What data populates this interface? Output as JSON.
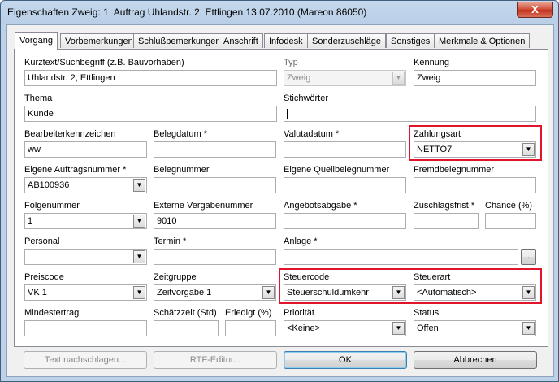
{
  "window": {
    "title": "Eigenschaften Zweig: 1. Auftrag Uhlandstr. 2, Ettlingen 13.07.2010 (Mareon 86050)",
    "close_label": "X"
  },
  "tabs": [
    "Vorgang",
    "Vorbemerkungen",
    "Schlußbemerkungen",
    "Anschrift",
    "Infodesk",
    "Sonderzuschläge",
    "Sonstiges",
    "Merkmale & Optionen"
  ],
  "fields": {
    "kurztext": {
      "label": "Kurztext/Suchbegriff (z.B. Bauvorhaben)",
      "value": "Uhlandstr. 2, Ettlingen"
    },
    "typ": {
      "label": "Typ",
      "value": "Zweig"
    },
    "kennung": {
      "label": "Kennung",
      "value": "Zweig"
    },
    "thema": {
      "label": "Thema",
      "value": "Kunde"
    },
    "stichwoerter": {
      "label": "Stichwörter",
      "value": ""
    },
    "bearbeiterkennzeichen": {
      "label": "Bearbeiterkennzeichen",
      "value": "ww"
    },
    "belegdatum": {
      "label": "Belegdatum *",
      "value": ""
    },
    "valutadatum": {
      "label": "Valutadatum *",
      "value": ""
    },
    "zahlungsart": {
      "label": "Zahlungsart",
      "value": "NETTO7"
    },
    "eigene_auftragsnummer": {
      "label": "Eigene Auftragsnummer *",
      "value": "AB100936"
    },
    "belegnummer": {
      "label": "Belegnummer",
      "value": ""
    },
    "eigene_quellbelegnummer": {
      "label": "Eigene Quellbelegnummer",
      "value": ""
    },
    "fremdbelegnummer": {
      "label": "Fremdbelegnummer",
      "value": ""
    },
    "folgenummer": {
      "label": "Folgenummer",
      "value": "1"
    },
    "externe_vergabenummer": {
      "label": "Externe Vergabenummer",
      "value": "9010"
    },
    "angebotsabgabe": {
      "label": "Angebotsabgabe *",
      "value": ""
    },
    "zuschlagsfrist": {
      "label": "Zuschlagsfrist *",
      "value": ""
    },
    "chance": {
      "label": "Chance (%)",
      "value": ""
    },
    "personal": {
      "label": "Personal",
      "value": ""
    },
    "termin": {
      "label": "Termin *",
      "value": ""
    },
    "anlage": {
      "label": "Anlage *",
      "value": "",
      "browse_label": "..."
    },
    "preiscode": {
      "label": "Preiscode",
      "value": "VK 1"
    },
    "zeitgruppe": {
      "label": "Zeitgruppe",
      "value": "Zeitvorgabe 1"
    },
    "steuercode": {
      "label": "Steuercode",
      "value": "Steuerschuldumkehr"
    },
    "steuerart": {
      "label": "Steuerart",
      "value": "<Automatisch>"
    },
    "mindestertrag": {
      "label": "Mindestertrag",
      "value": ""
    },
    "schaetzzeit": {
      "label": "Schätzzeit (Std)",
      "value": ""
    },
    "erledigt": {
      "label": "Erledigt (%)",
      "value": ""
    },
    "prioritaet": {
      "label": "Priorität",
      "value": "<Keine>"
    },
    "status": {
      "label": "Status",
      "value": "Offen"
    }
  },
  "buttons": {
    "text_nachschlagen": "Text nachschlagen...",
    "rtf_editor": "RTF-Editor...",
    "ok": "OK",
    "abbrechen": "Abbrechen"
  },
  "icons": {
    "dropdown": "▼"
  },
  "colors": {
    "highlight": "#e0152a"
  }
}
